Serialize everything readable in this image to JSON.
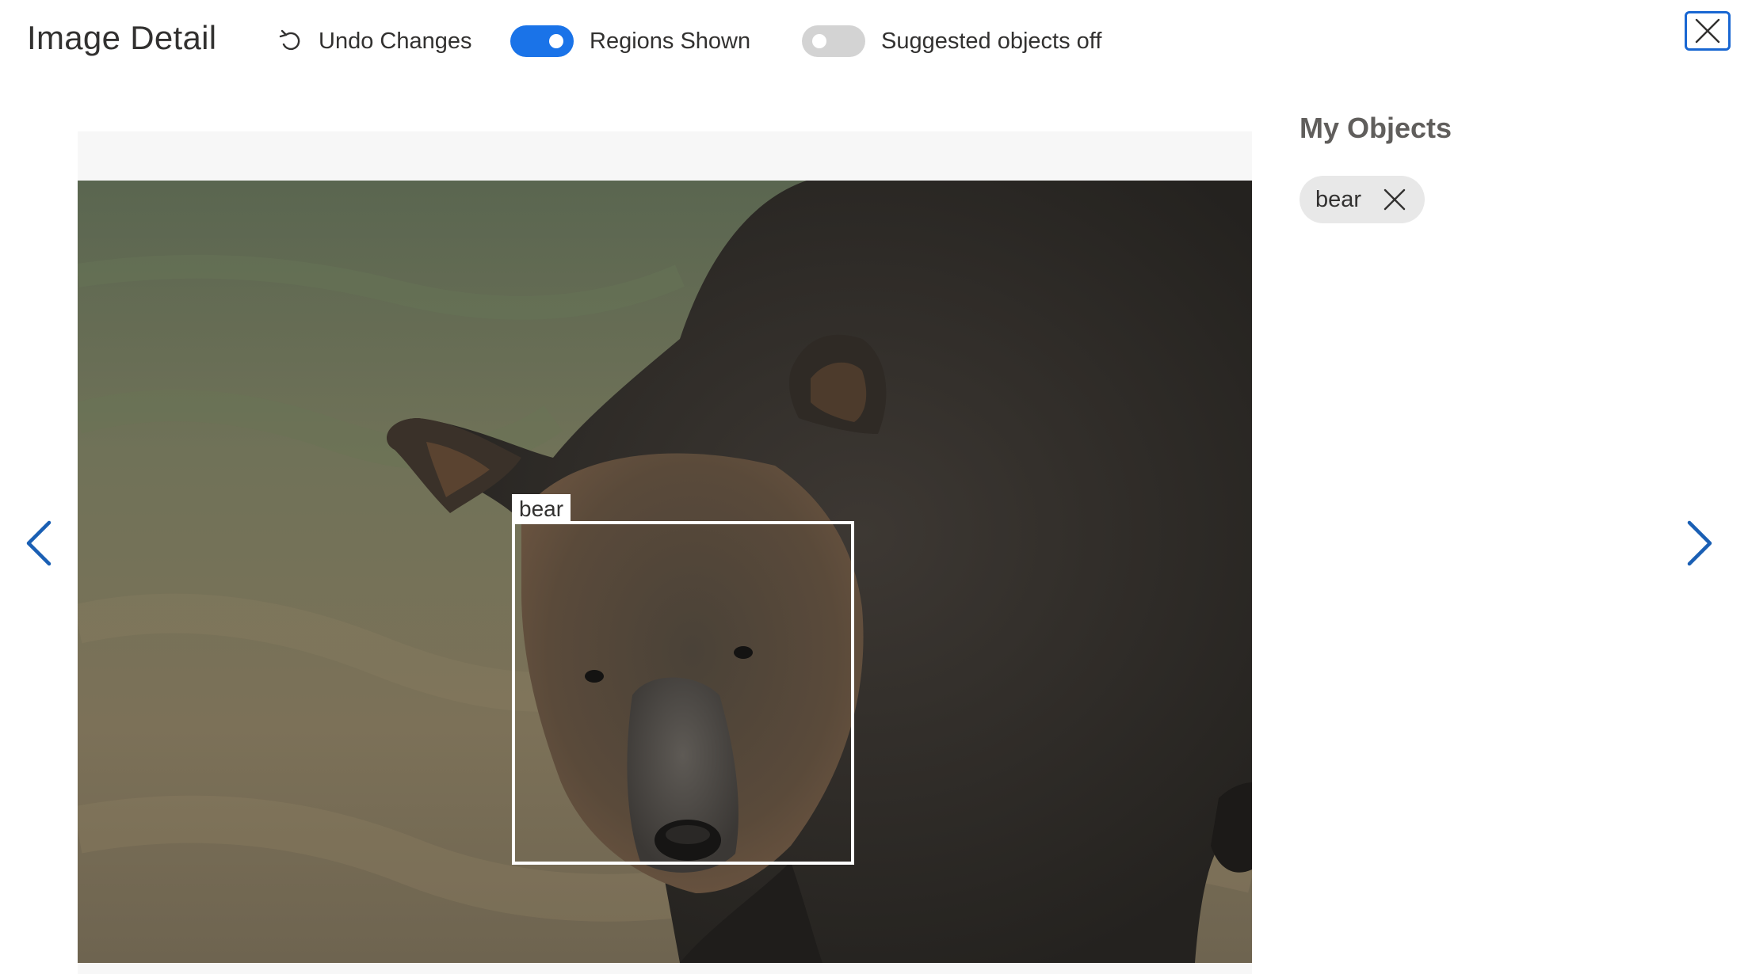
{
  "header": {
    "title": "Image Detail",
    "undo_label": "Undo Changes",
    "undo_icon": "undo-icon",
    "regions_toggle": {
      "label": "Regions Shown",
      "state": "on"
    },
    "suggested_toggle": {
      "label": "Suggested objects off",
      "state": "off"
    },
    "close_icon": "close-icon"
  },
  "viewer": {
    "prev_icon": "chevron-left-icon",
    "next_icon": "chevron-right-icon",
    "regions": [
      {
        "label": "bear"
      }
    ]
  },
  "panel": {
    "title": "My Objects",
    "tags": [
      {
        "label": "bear",
        "remove_icon": "close-icon"
      }
    ]
  },
  "colors": {
    "accent": "#1a73e8",
    "toggle_off": "#d3d3d3",
    "chip_background": "#e8e8e8",
    "region_border": "#ffffff"
  }
}
